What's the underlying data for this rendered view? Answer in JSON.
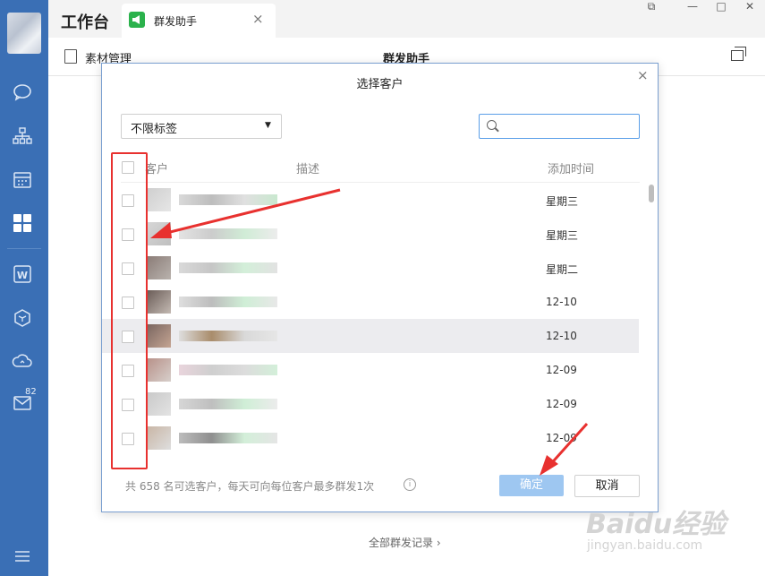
{
  "app": {
    "title": "工作台"
  },
  "tab": {
    "label": "群发助手",
    "close": "×"
  },
  "window_controls": [
    "⧉",
    "—",
    "□",
    "✕"
  ],
  "page": {
    "left_label": "素材管理",
    "center_title": "群发助手",
    "footer_link": "全部群发记录 ›"
  },
  "sidebar": {
    "icons": [
      "avatar",
      "chat-icon",
      "org-icon",
      "calendar-icon",
      "workbench-icon",
      "doc-icon",
      "box-icon",
      "cloud-icon",
      "mail-icon",
      "menu-icon"
    ],
    "mail_badge": "82"
  },
  "modal": {
    "title": "选择客户",
    "close": "×",
    "tag_select": {
      "value": "不限标签",
      "arrow": "▼"
    },
    "search": {
      "placeholder": ""
    },
    "columns": {
      "customer": "客户",
      "description": "描述",
      "added_time": "添加时间"
    },
    "rows": [
      {
        "time": "星期三"
      },
      {
        "time": "星期三"
      },
      {
        "time": "星期二"
      },
      {
        "time": "12-10"
      },
      {
        "time": "12-10"
      },
      {
        "time": "12-09"
      },
      {
        "time": "12-09"
      },
      {
        "time": "12-09"
      }
    ],
    "info_text": "共 658 名可选客户，每天可向每位客户最多群发1次",
    "info_icon": "i",
    "confirm": "确定",
    "cancel": "取消"
  },
  "watermark": {
    "brand": "Baidu经验",
    "url": "jingyan.baidu.com"
  },
  "colors": {
    "sidebar": "#3a6fb5",
    "accent": "#5a9ee8",
    "confirm_disabled": "#9ec7f1",
    "annotation": "#e8312f"
  }
}
